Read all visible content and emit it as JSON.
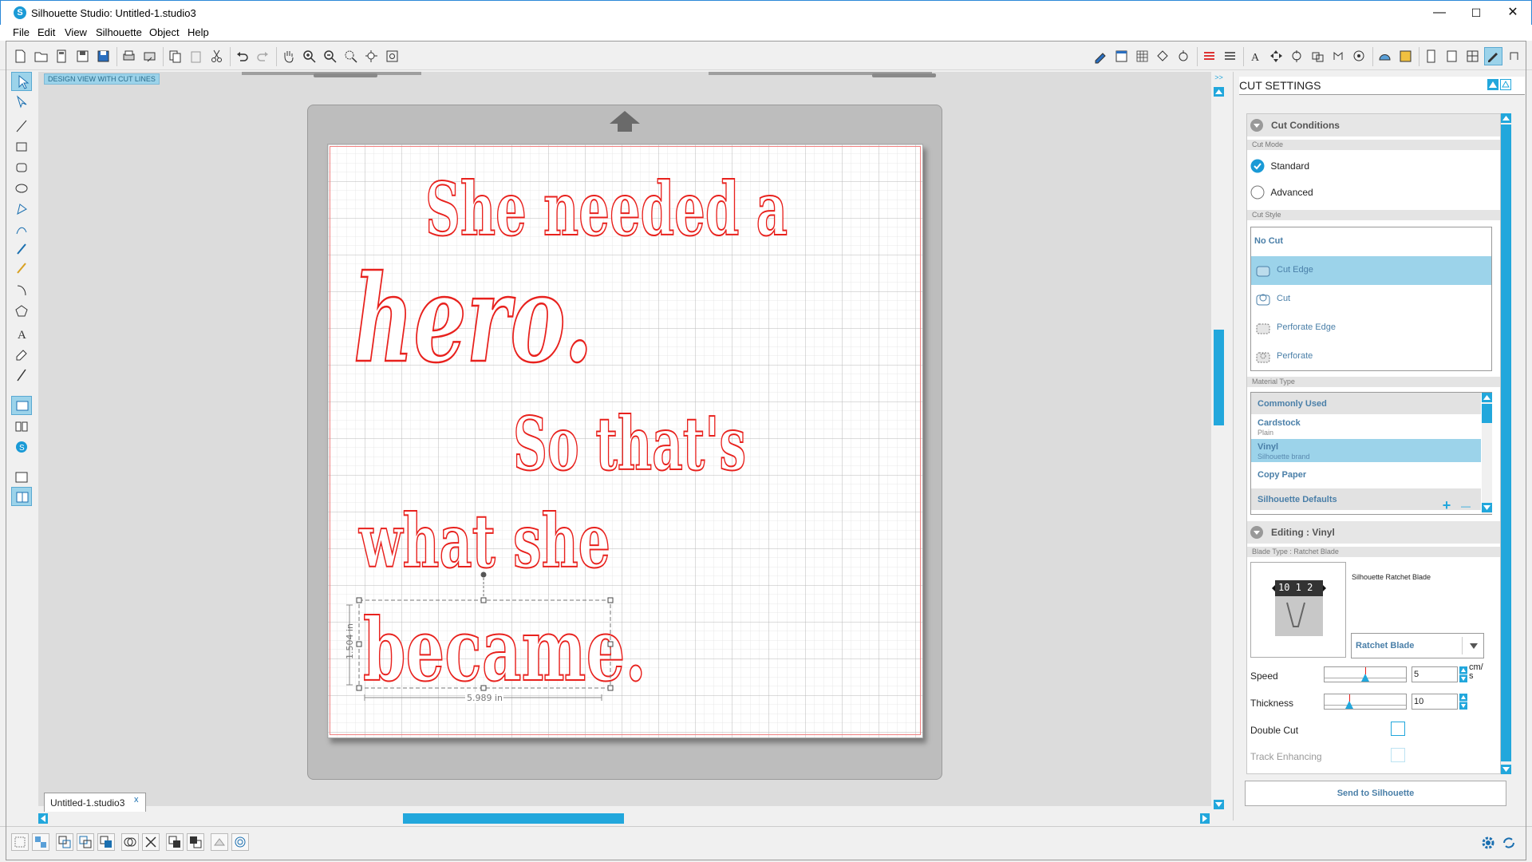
{
  "window": {
    "title": "Silhouette Studio: Untitled-1.studio3",
    "minimize": "—",
    "maximize": "☐",
    "close": "✕"
  },
  "menu": [
    "File",
    "Edit",
    "View",
    "Silhouette",
    "Object",
    "Help"
  ],
  "canvas": {
    "view_label": "DESIGN VIEW WITH CUT LINES",
    "lines": [
      "She needed a",
      "hero.",
      "So that's",
      "what she",
      "became."
    ],
    "height_dim": "1.504 in",
    "width_dim": "5.989 in",
    "doc_tab": "Untitled-1.studio3",
    "doc_tab_close": "x"
  },
  "panel": {
    "title": "CUT SETTINGS",
    "cut_conditions": "Cut Conditions",
    "cut_mode_label": "Cut Mode",
    "modes": [
      {
        "label": "Standard",
        "checked": true
      },
      {
        "label": "Advanced",
        "checked": false
      }
    ],
    "cut_style_label": "Cut Style",
    "cut_styles": [
      "No Cut",
      "Cut Edge",
      "Cut",
      "Perforate Edge",
      "Perforate"
    ],
    "selected_cut_style": "Cut Edge",
    "material_type_label": "Material Type",
    "materials": [
      {
        "name": "Commonly Used",
        "sub": "",
        "kind": "header"
      },
      {
        "name": "Cardstock",
        "sub": "Plain",
        "kind": "item"
      },
      {
        "name": "Vinyl",
        "sub": "Silhouette brand",
        "kind": "selected"
      },
      {
        "name": "Copy Paper",
        "sub": "",
        "kind": "item"
      },
      {
        "name": "Silhouette Defaults",
        "sub": "",
        "kind": "header"
      }
    ],
    "add_btn": "+",
    "remove_btn": "—",
    "editing": "Editing : Vinyl",
    "blade_type_label": "Blade Type : Ratchet Blade",
    "blade_name": "Silhouette Ratchet Blade",
    "blade_numbers": "10 1 2",
    "blade_select": "Ratchet Blade",
    "speed_label": "Speed",
    "speed_value": "5",
    "speed_unit": "cm/ s",
    "speed_level": 0.5,
    "thickness_label": "Thickness",
    "thickness_value": "10",
    "thickness_level": 0.3,
    "double_cut_label": "Double Cut",
    "track_enhancing_label": "Track Enhancing",
    "send_button": "Send to Silhouette"
  },
  "colors": {
    "accent": "#1a9ad6",
    "selection": "#9cd3ea",
    "cut_line": "#e8211d",
    "scroll_thumb": "#22a7dc"
  }
}
